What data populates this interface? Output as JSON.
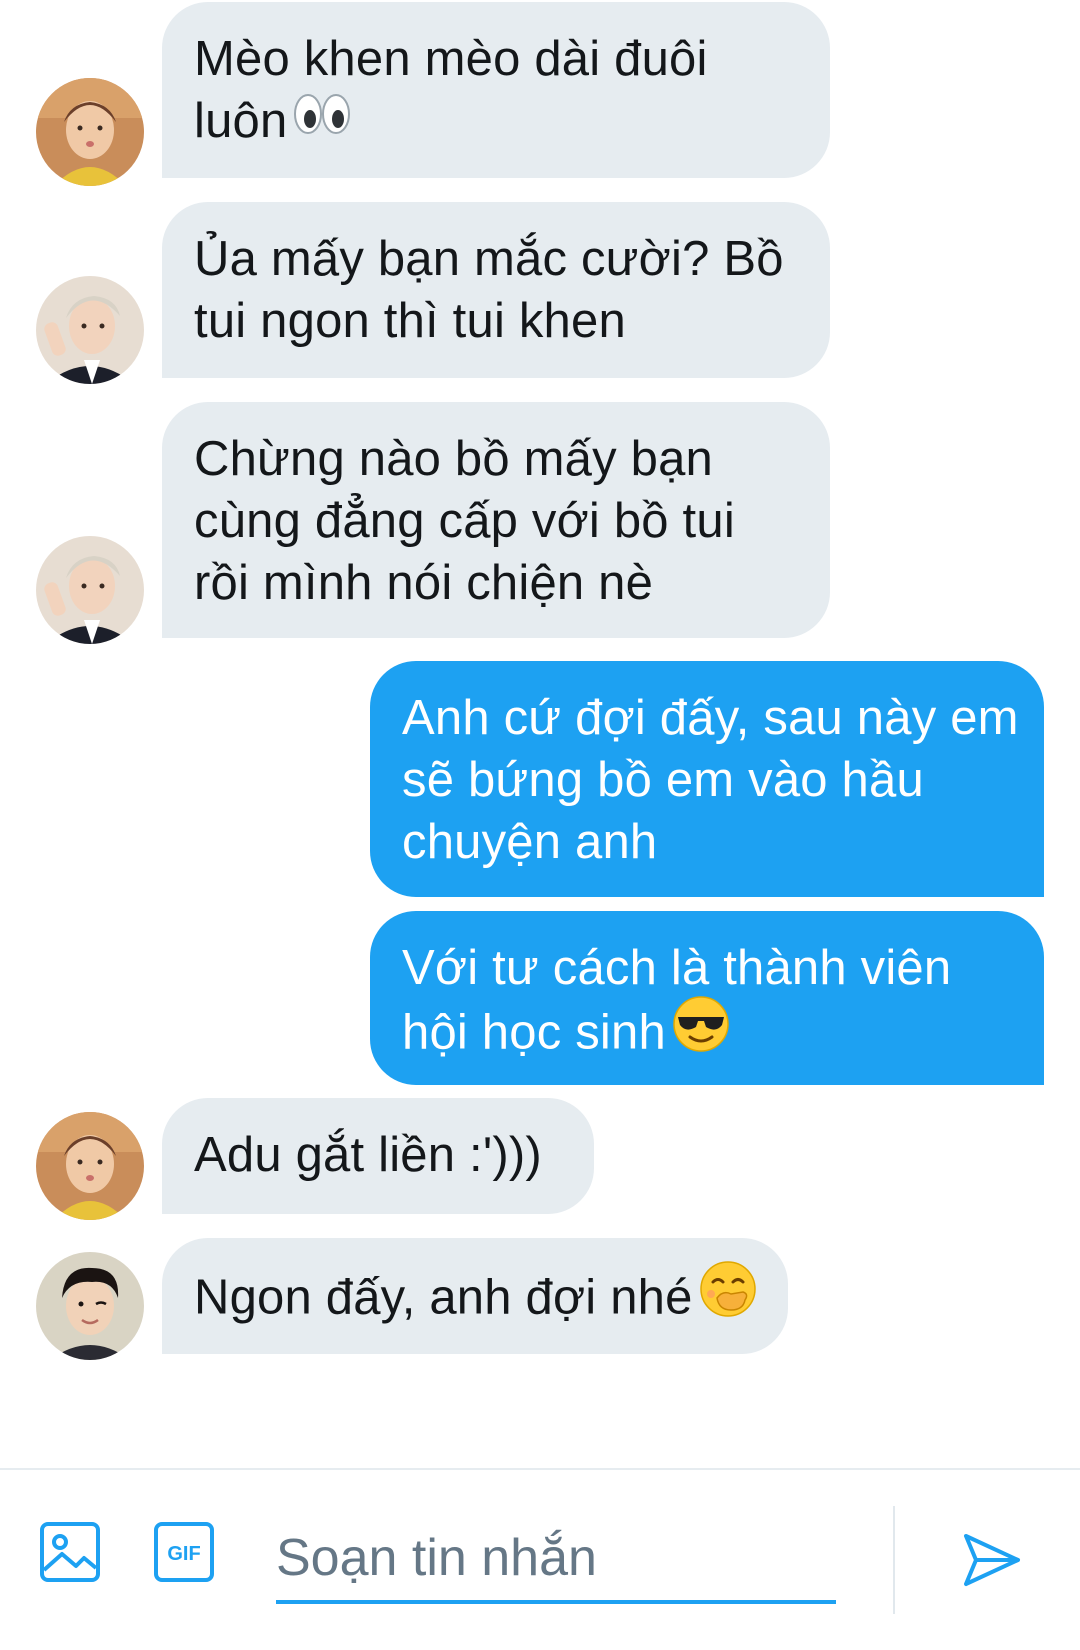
{
  "messages": [
    {
      "direction": "incoming",
      "avatar": "avatar-user-1",
      "lines": [
        "Mèo khen mèo dài đuôi",
        "luôn"
      ],
      "emoji": "eyes-emoji"
    },
    {
      "direction": "incoming",
      "avatar": "avatar-user-2",
      "lines": [
        "Ủa mấy bạn mắc cười? Bồ",
        "tui ngon thì tui khen"
      ]
    },
    {
      "direction": "incoming",
      "avatar": "avatar-user-2",
      "lines": [
        "Chừng nào bồ mấy bạn",
        "cùng đẳng cấp với bồ tui",
        "rồi mình nói chiện nè"
      ]
    },
    {
      "direction": "outgoing",
      "lines": [
        "Anh cứ đợi đấy, sau này em",
        "sẽ bứng bồ em vào hầu",
        "chuyện anh"
      ]
    },
    {
      "direction": "outgoing",
      "lines": [
        "Với tư cách là thành viên",
        "hội học sinh"
      ],
      "emoji": "sunglasses-emoji"
    },
    {
      "direction": "incoming",
      "avatar": "avatar-user-1",
      "lines": [
        "Adu gắt liền :')))"
      ]
    },
    {
      "direction": "incoming",
      "avatar": "avatar-user-3",
      "lines": [
        "Ngon đấy, anh đợi nhé"
      ],
      "emoji": "hand-over-mouth-emoji"
    }
  ],
  "composer": {
    "placeholder": "Soạn tin nhắn",
    "gif_label": "GIF",
    "media_icon": "image-icon",
    "send_icon": "send-icon"
  },
  "colors": {
    "incoming_bubble": "#e6ecf0",
    "outgoing_bubble": "#1da1f2",
    "accent": "#1da1f2"
  }
}
